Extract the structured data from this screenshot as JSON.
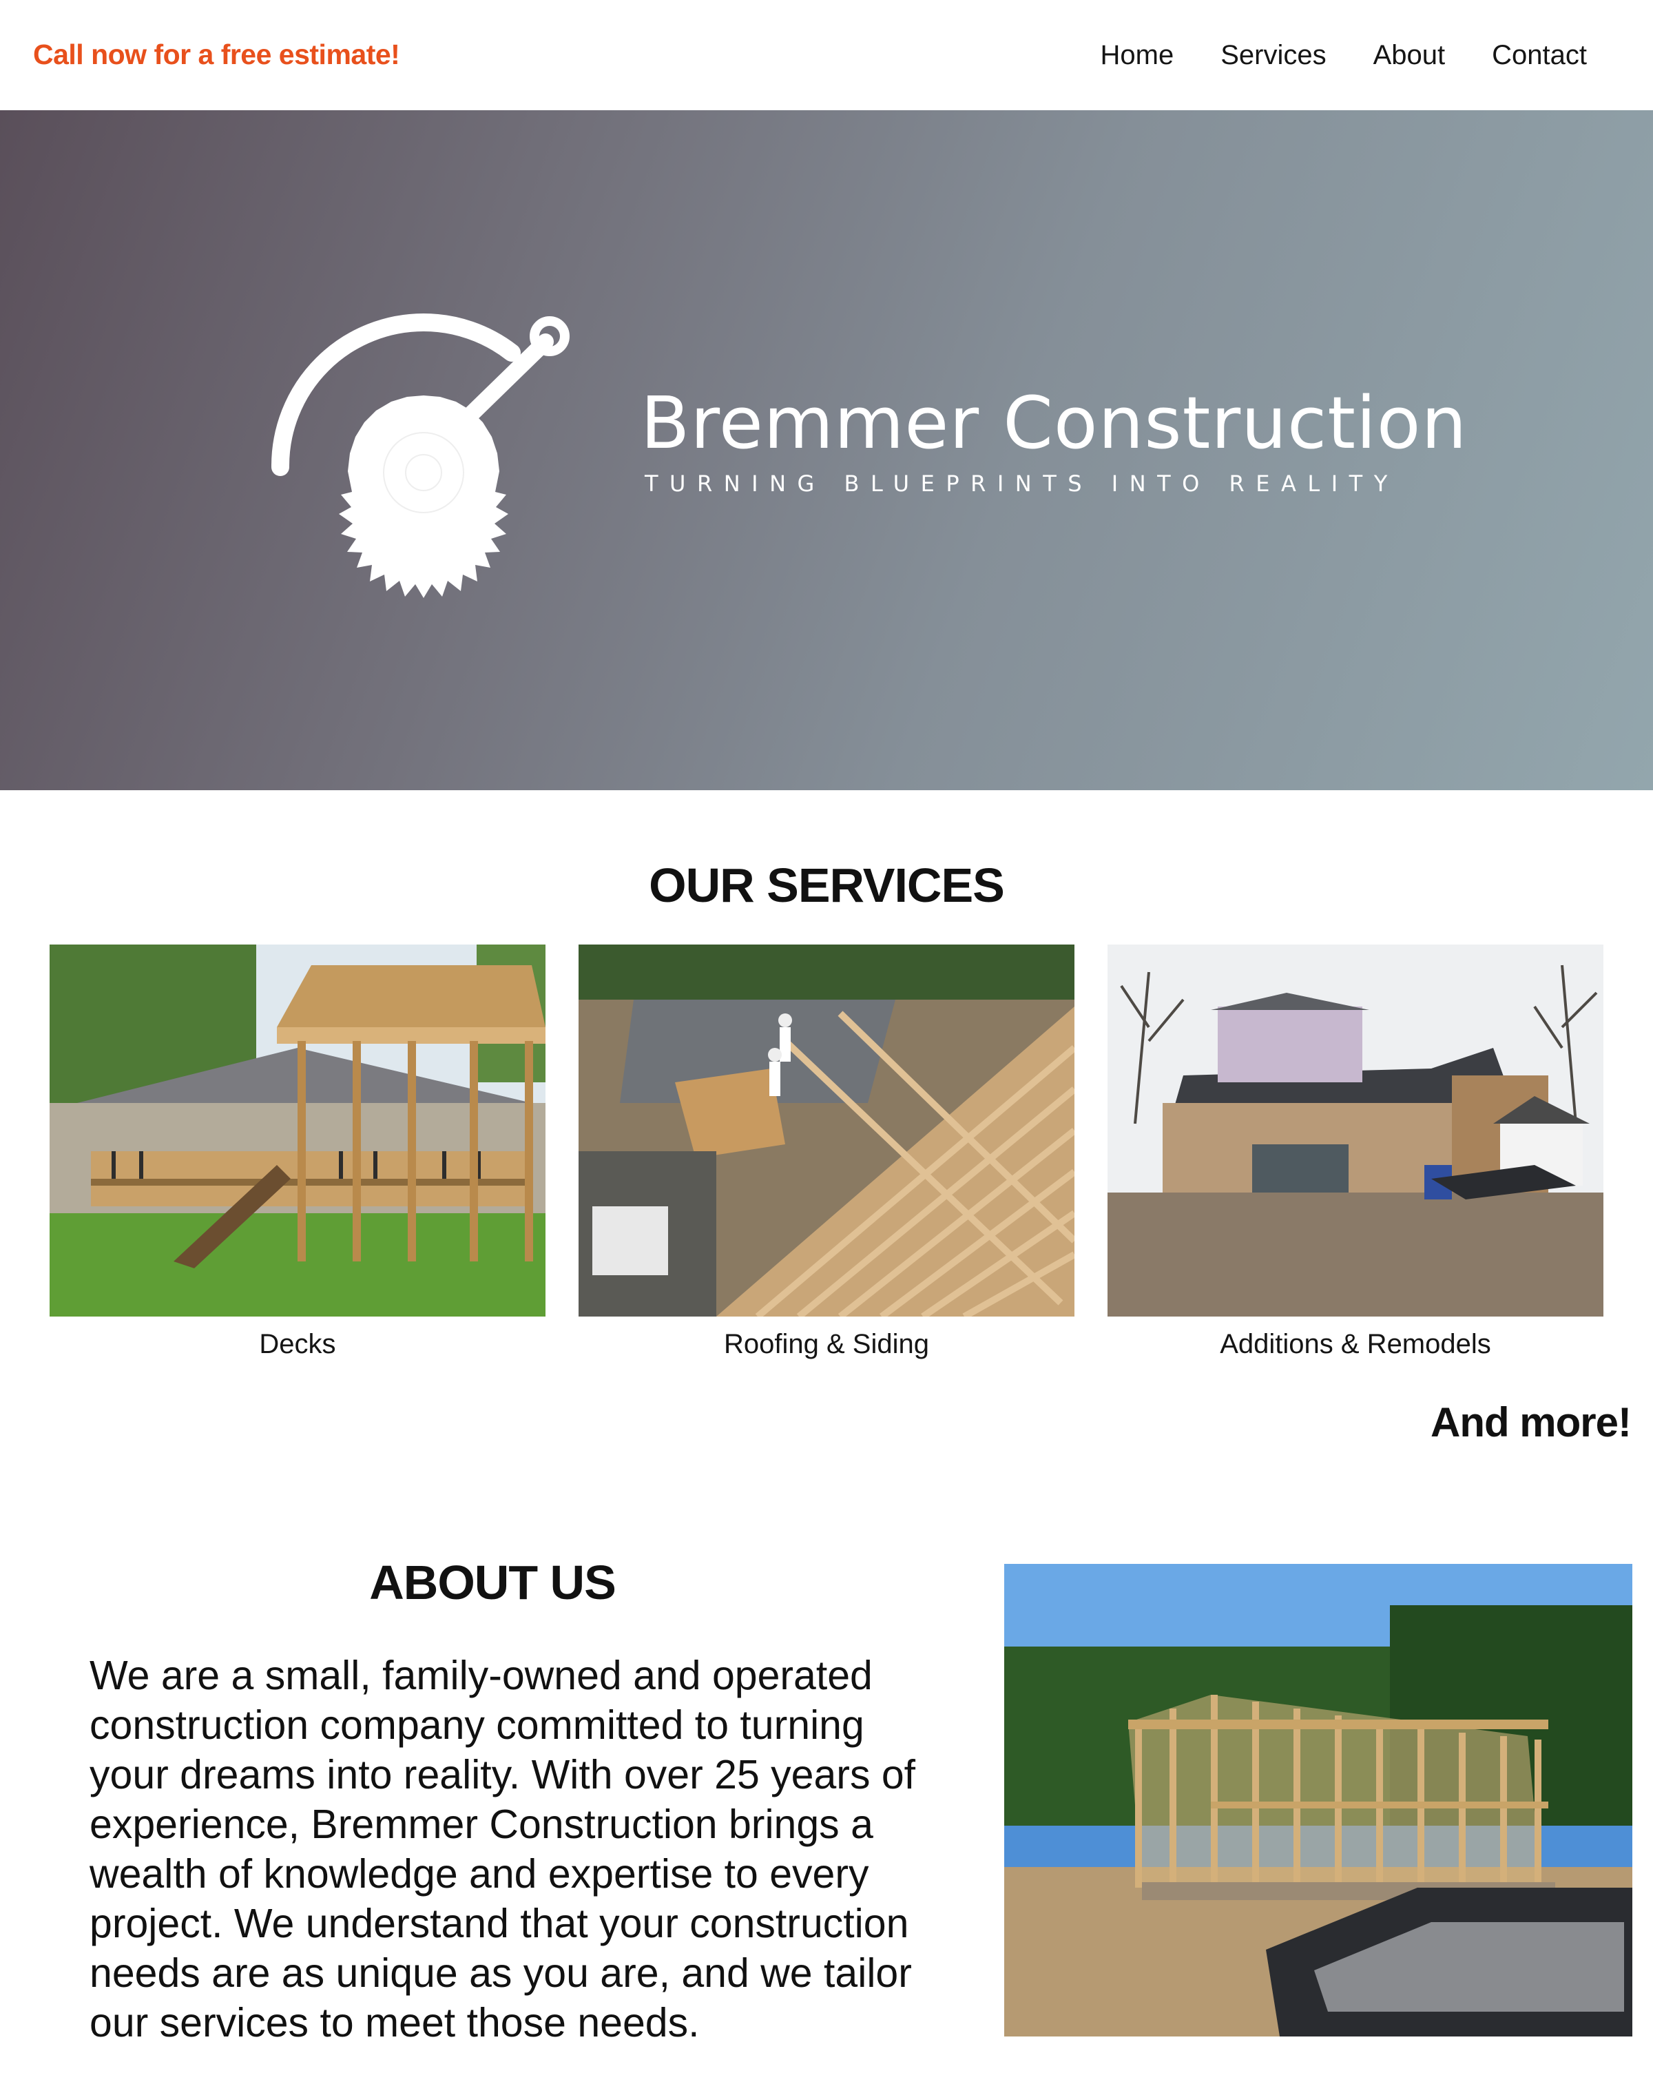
{
  "header": {
    "cta": "Call now for a free estimate!",
    "nav": [
      "Home",
      "Services",
      "About",
      "Contact"
    ]
  },
  "hero": {
    "logo_icon": "circular-saw-blade-icon",
    "brand_name": "Bremmer Construction",
    "tagline": "TURNING BLUEPRINTS INTO REALITY"
  },
  "services": {
    "title": "OUR SERVICES",
    "items": [
      {
        "caption": "Decks"
      },
      {
        "caption": "Roofing & Siding"
      },
      {
        "caption": "Additions & Remodels"
      }
    ],
    "more": "And more!"
  },
  "about": {
    "title": "ABOUT US",
    "text": "We are a small, family-owned and operated construction company committed to turning your dreams into reality. With over 25 years of experience, Bremmer Construction brings a wealth of knowledge and expertise to every project. We understand that your construction needs are as unique as you are, and we tailor our services to meet those needs."
  },
  "colors": {
    "accent": "#e8501c",
    "hero_start": "#5a4f5a",
    "hero_end": "#93a6ad"
  }
}
